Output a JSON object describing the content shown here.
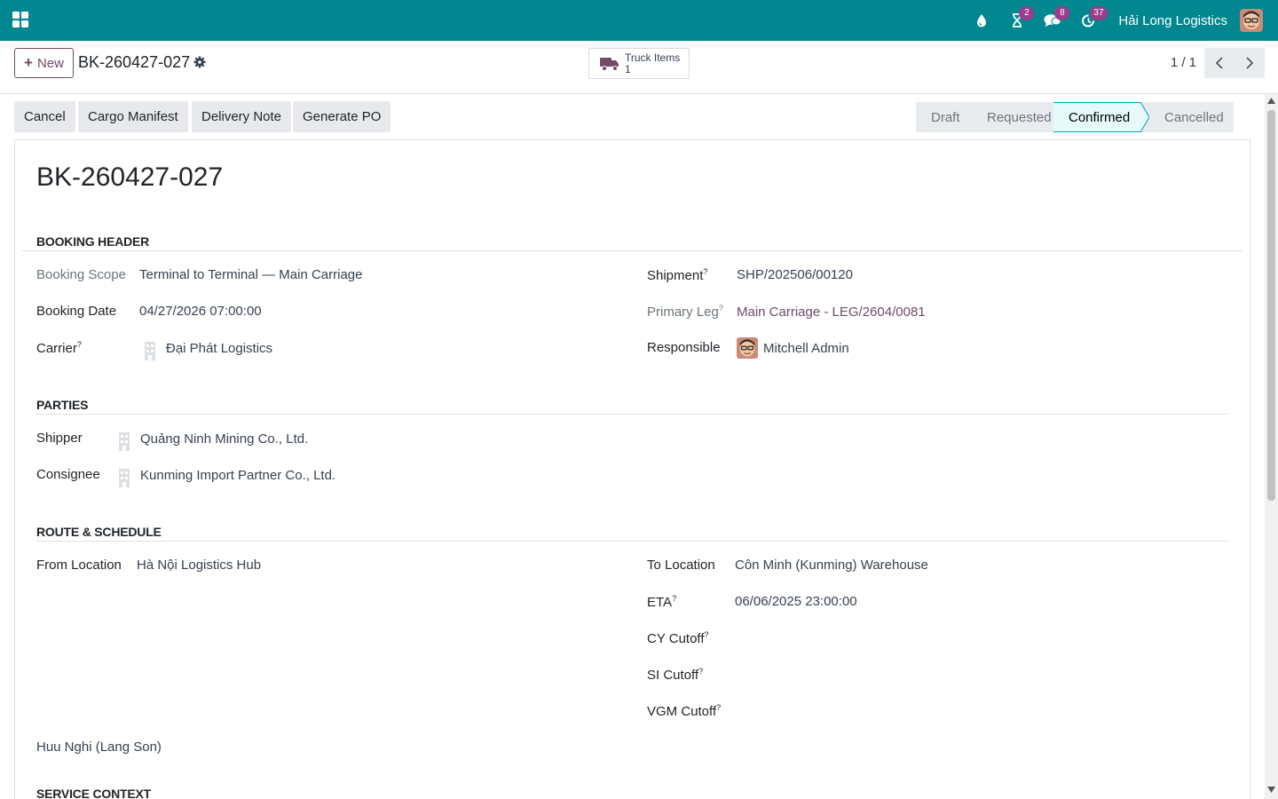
{
  "navbar": {
    "company": "Hải Long Logistics",
    "badges": {
      "activities": "2",
      "messages": "8",
      "updates": "37"
    },
    "brand_color": "#00878f"
  },
  "control": {
    "new_label": "New",
    "breadcrumb": "BK-260427-027",
    "smart_button": {
      "label": "Truck Items",
      "count": "1"
    },
    "pager": "1 / 1"
  },
  "actions": [
    "Cancel",
    "Cargo Manifest",
    "Delivery Note",
    "Generate PO"
  ],
  "status": {
    "stages": [
      "Draft",
      "Requested",
      "Confirmed",
      "Cancelled"
    ],
    "active": "Confirmed"
  },
  "record": {
    "title": "BK-260427-027",
    "booking_header": {
      "section": "BOOKING HEADER",
      "booking_scope_label": "Booking Scope",
      "booking_scope": "Terminal to Terminal — Main Carriage",
      "booking_date_label": "Booking Date",
      "booking_date": "04/27/2026 07:00:00",
      "carrier_label": "Carrier",
      "carrier": "Đại Phát Logistics",
      "shipment_label": "Shipment",
      "shipment": "SHP/202506/00120",
      "primary_leg_label": "Primary Leg",
      "primary_leg": "Main Carriage - LEG/2604/0081",
      "responsible_label": "Responsible",
      "responsible": "Mitchell Admin"
    },
    "parties": {
      "section": "PARTIES",
      "shipper_label": "Shipper",
      "shipper": "Quảng Ninh Mining Co., Ltd.",
      "consignee_label": "Consignee",
      "consignee": "Kunming Import Partner Co., Ltd."
    },
    "route": {
      "section": "ROUTE & SCHEDULE",
      "from_label": "From Location",
      "from": "Hà Nội Logistics Hub",
      "to_label": "To Location",
      "to": "Côn Minh (Kunming) Warehouse",
      "eta_label": "ETA",
      "eta": "06/06/2025 23:00:00",
      "cy_cutoff_label": "CY Cutoff",
      "si_cutoff_label": "SI Cutoff",
      "vgm_cutoff_label": "VGM Cutoff",
      "border_gate": "Huu Nghi (Lang Son)"
    },
    "service_context": {
      "section": "SERVICE CONTEXT"
    },
    "help_mark": "?"
  }
}
